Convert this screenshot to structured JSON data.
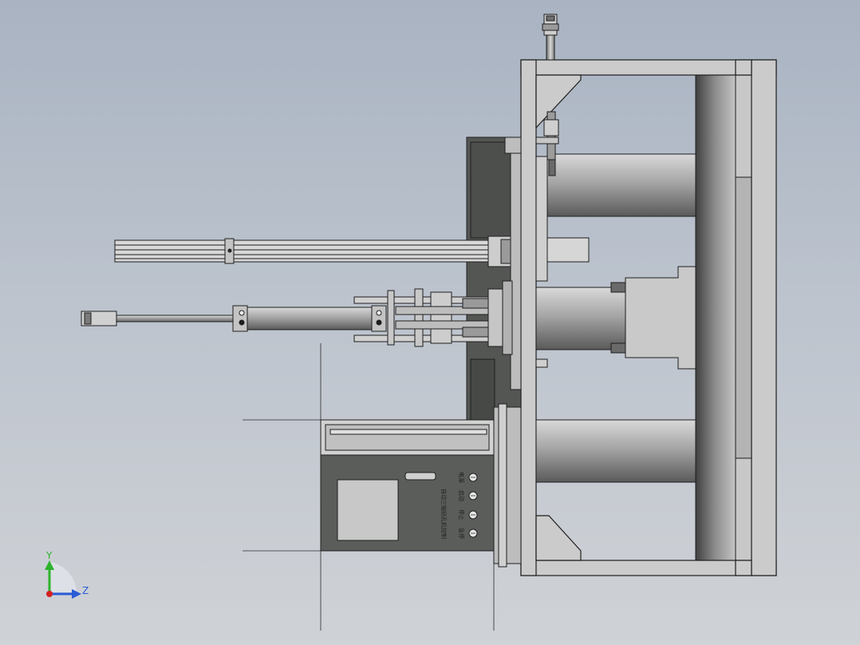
{
  "axes": {
    "y_label": "Y",
    "z_label": "Z",
    "colors": {
      "y": "#2db32d",
      "z": "#2a5bd7",
      "origin": "#d42020"
    }
  },
  "control_panel": {
    "title": "自动三轴钻孔机控制",
    "buttons": [
      {
        "label": "电源",
        "icon": "indicator-lamp-icon"
      },
      {
        "label": "启动",
        "icon": "indicator-lamp-icon"
      },
      {
        "label": "停止",
        "icon": "indicator-lamp-icon"
      },
      {
        "label": "急停",
        "icon": "indicator-lamp-icon"
      }
    ]
  },
  "colors": {
    "frame": "#cfcfcf",
    "frame_dark": "#9a9a9a",
    "cylinder_light": "#d6d6d6",
    "cylinder_dark": "#5e5e5e",
    "housing_dark": "#575a57",
    "panel_face": "#5b5d5b"
  }
}
